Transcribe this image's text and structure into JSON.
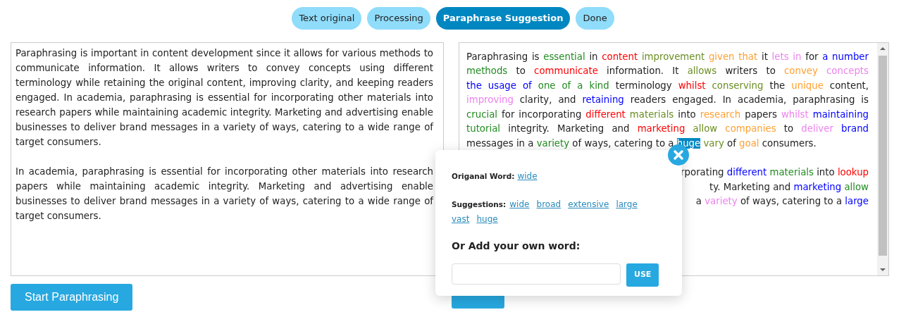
{
  "steps": [
    {
      "label": "Text original",
      "selected": false
    },
    {
      "label": "Processing",
      "selected": false
    },
    {
      "label": "Paraphrase Suggestion",
      "selected": true
    },
    {
      "label": "Done",
      "selected": false
    }
  ],
  "original_text": {
    "paragraphs": [
      "Paraphrasing is important in content development since it allows for various methods to communicate information. It allows writers to convey concepts using different terminology while retaining the original content, improving clarity, and keeping readers engaged. In academia, paraphrasing is essential for incorporating other materials into research papers while maintaining academic integrity. Marketing and advertising enable businesses to deliver brand messages in a variety of ways, catering to a wide range of target consumers.",
      "In academia, paraphrasing is essential for incorporating other materials into research papers while maintaining academic integrity. Marketing and advertising enable businesses to deliver brand messages in a variety of ways, catering to a wide range of target consumers."
    ]
  },
  "paraphrased_text": {
    "paragraph": [
      {
        "kind": "plain",
        "text": "Paraphrasing is"
      },
      {
        "kind": "colored",
        "text": "essential",
        "color": "#228b22"
      },
      {
        "kind": "plain",
        "text": "in"
      },
      {
        "kind": "colored",
        "text": "content",
        "color": "#ff0000"
      },
      {
        "kind": "colored",
        "text": "improvement",
        "color": "#6b8e23"
      },
      {
        "kind": "colored",
        "text": "given that",
        "color": "#ffa033"
      },
      {
        "kind": "plain",
        "text": "it"
      },
      {
        "kind": "colored",
        "text": "lets in",
        "color": "#ee82ee"
      },
      {
        "kind": "plain",
        "text": "for"
      },
      {
        "kind": "colored",
        "text": "a number",
        "color": "#0000ff"
      },
      {
        "kind": "colored",
        "text": "methods",
        "color": "#228b22"
      },
      {
        "kind": "plain",
        "text": "to"
      },
      {
        "kind": "colored",
        "text": "communicate",
        "color": "#ff0000"
      },
      {
        "kind": "plain",
        "text": "information. It"
      },
      {
        "kind": "colored",
        "text": "allows",
        "color": "#6b8e23"
      },
      {
        "kind": "plain",
        "text": "writers to"
      },
      {
        "kind": "colored",
        "text": "convey",
        "color": "#ffa033"
      },
      {
        "kind": "colored",
        "text": "concepts",
        "color": "#ee82ee"
      },
      {
        "kind": "colored",
        "text": "the usage of",
        "color": "#0000ff"
      },
      {
        "kind": "colored",
        "text": "one of a kind",
        "color": "#228b22"
      },
      {
        "kind": "plain",
        "text": "terminology"
      },
      {
        "kind": "colored",
        "text": "whilst",
        "color": "#ff0000"
      },
      {
        "kind": "colored",
        "text": "conserving",
        "color": "#6b8e23"
      },
      {
        "kind": "plain",
        "text": "the"
      },
      {
        "kind": "colored",
        "text": "unique",
        "color": "#ffa033"
      },
      {
        "kind": "plain",
        "text": "content,"
      },
      {
        "kind": "colored",
        "text": "improving",
        "color": "#ee82ee"
      },
      {
        "kind": "plain",
        "text": "clarity, and"
      },
      {
        "kind": "colored",
        "text": "retaining",
        "color": "#0000ff"
      },
      {
        "kind": "plain",
        "text": "readers engaged. In academia, paraphrasing is"
      },
      {
        "kind": "colored",
        "text": "crucial",
        "color": "#228b22"
      },
      {
        "kind": "plain",
        "text": "for incorporating"
      },
      {
        "kind": "colored",
        "text": "different",
        "color": "#ff0000"
      },
      {
        "kind": "colored",
        "text": "materials",
        "color": "#6b8e23"
      },
      {
        "kind": "plain",
        "text": "into"
      },
      {
        "kind": "colored",
        "text": "research",
        "color": "#ffa033"
      },
      {
        "kind": "plain",
        "text": "papers"
      },
      {
        "kind": "colored",
        "text": "whilst",
        "color": "#ee82ee"
      },
      {
        "kind": "colored",
        "text": "maintaining",
        "color": "#0000ff"
      },
      {
        "kind": "colored",
        "text": "tutorial",
        "color": "#228b22"
      },
      {
        "kind": "plain",
        "text": "integrity. Marketing and"
      },
      {
        "kind": "colored",
        "text": "marketing",
        "color": "#ff0000"
      },
      {
        "kind": "colored",
        "text": "allow",
        "color": "#6b8e23"
      },
      {
        "kind": "colored",
        "text": "companies",
        "color": "#ffa033"
      },
      {
        "kind": "plain",
        "text": "to"
      },
      {
        "kind": "colored",
        "text": "deliver",
        "color": "#ee82ee"
      },
      {
        "kind": "colored",
        "text": "brand",
        "color": "#0000ff"
      },
      {
        "kind": "plain",
        "text": "messages in a"
      },
      {
        "kind": "colored",
        "text": "variety",
        "color": "#228b22"
      },
      {
        "kind": "plain",
        "text": "of ways, catering to a"
      },
      {
        "kind": "selected",
        "text": "huge"
      },
      {
        "kind": "colored",
        "text": "vary",
        "color": "#6b8e23"
      },
      {
        "kind": "plain",
        "text": "of"
      },
      {
        "kind": "colored",
        "text": "goal",
        "color": "#ffa033"
      },
      {
        "kind": "plain",
        "text": "consumers."
      }
    ],
    "partly_covered_lines": [
      [
        {
          "kind": "plain",
          "text": "rporating"
        },
        {
          "kind": "colored",
          "text": "different",
          "color": "#0000ff"
        },
        {
          "kind": "colored",
          "text": "materials",
          "color": "#228b22"
        },
        {
          "kind": "plain",
          "text": "into"
        },
        {
          "kind": "colored",
          "text": "lookup",
          "color": "#ff0000"
        }
      ],
      [
        {
          "kind": "plain",
          "text": "ty. Marketing and"
        },
        {
          "kind": "colored",
          "text": "marketing",
          "color": "#0000ff"
        },
        {
          "kind": "colored",
          "text": "allow",
          "color": "#228b22"
        }
      ],
      [
        {
          "kind": "plain",
          "text": "a"
        },
        {
          "kind": "colored",
          "text": "variety",
          "color": "#ee82ee"
        },
        {
          "kind": "plain",
          "text": "of ways, catering to a"
        },
        {
          "kind": "colored",
          "text": "large",
          "color": "#0000ff"
        }
      ]
    ]
  },
  "start_button": "Start Paraphrasing",
  "popup": {
    "original_label": "Origanal Word:",
    "original_word": "wide",
    "suggestions_label": "Suggestions:",
    "suggestions": [
      "wide",
      "broad",
      "extensive",
      "large",
      "vast",
      "huge"
    ],
    "add_label": "Or Add your own word:",
    "use_button": "USE"
  }
}
